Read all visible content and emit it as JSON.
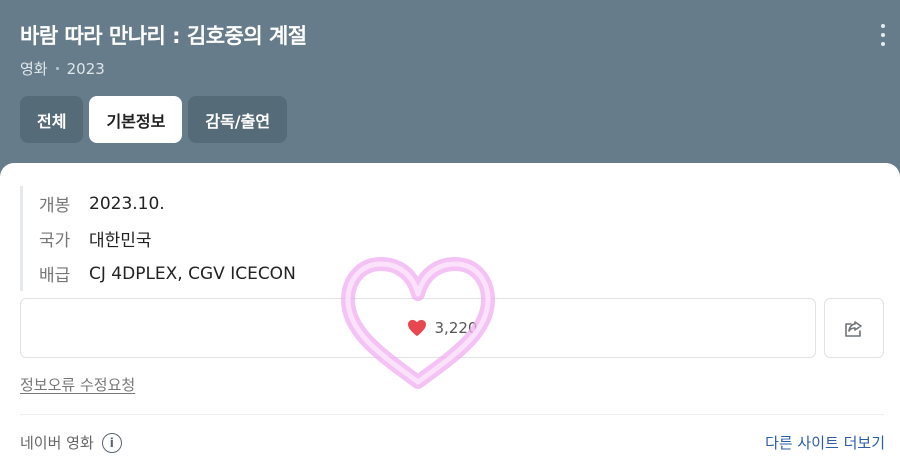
{
  "header": {
    "title": "바람 따라 만나리 : 김호중의 계절",
    "meta": {
      "category": "영화",
      "year": "2023"
    },
    "tabs": [
      {
        "label": "전체",
        "active": false
      },
      {
        "label": "기본정보",
        "active": true
      },
      {
        "label": "감독/출연",
        "active": false
      }
    ],
    "more_icon": "more-vertical-icon"
  },
  "info": [
    {
      "key": "개봉",
      "value": "2023.10."
    },
    {
      "key": "국가",
      "value": "대한민국"
    },
    {
      "key": "배급",
      "value": "CJ 4DPLEX, CGV ICECON"
    }
  ],
  "like": {
    "count": "3,220",
    "icon": "heart-icon",
    "color": "#e8474f"
  },
  "share": {
    "icon": "share-icon"
  },
  "report_link": "정보오류 수정요청",
  "footer": {
    "source": "네이버 영화",
    "info_icon": "info-icon",
    "other_sites": "다른 사이트 더보기"
  },
  "colors": {
    "header_bg": "#667c8a",
    "tab_bg": "#566b78",
    "link": "#2a5ea8",
    "sticker": "#f3b6f0"
  }
}
